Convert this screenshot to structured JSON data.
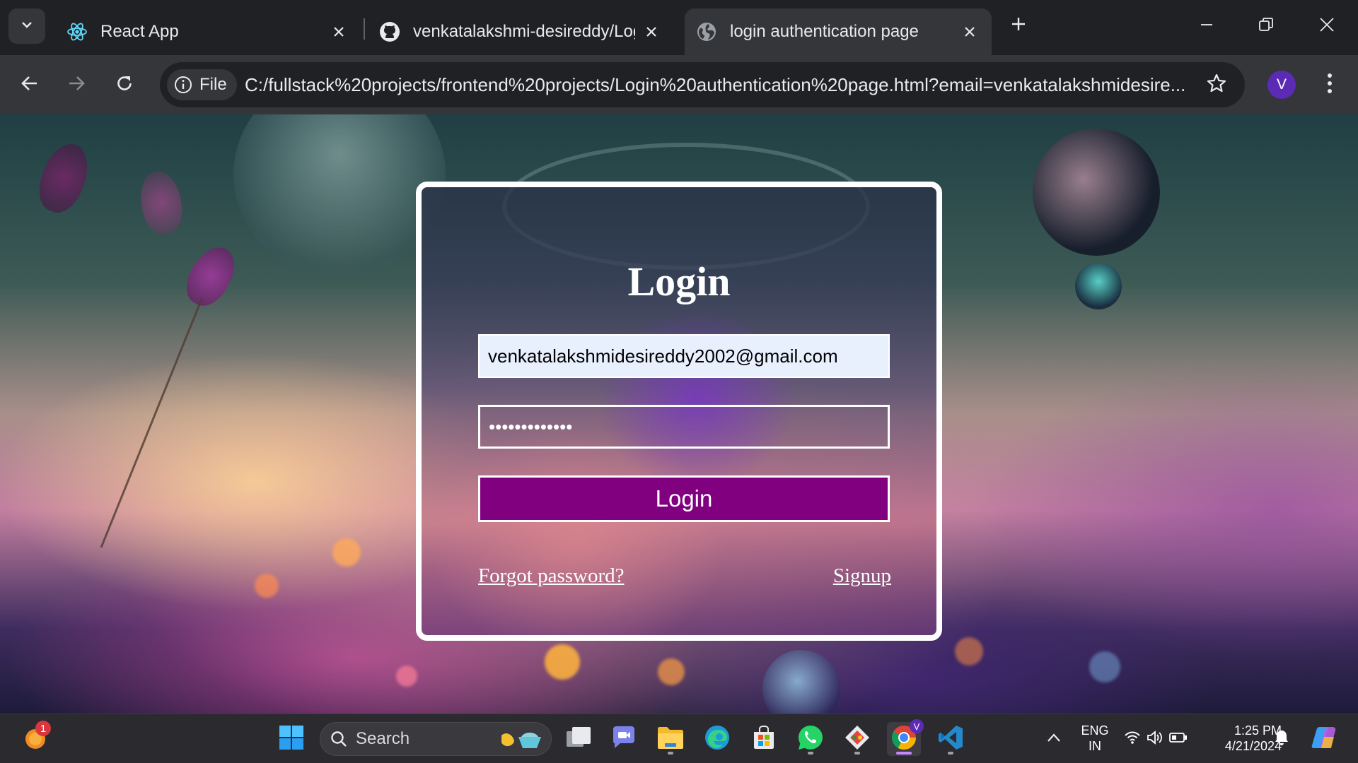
{
  "browser": {
    "tabs": [
      {
        "title": "React App",
        "favicon": "react-icon",
        "active": false
      },
      {
        "title": "venkatalakshmi-desireddy/Log",
        "favicon": "github-icon",
        "active": false
      },
      {
        "title": "login authentication page",
        "favicon": "globe-icon",
        "active": true
      }
    ],
    "site_chip": "File",
    "url": "C:/fullstack%20projects/frontend%20projects/Login%20authentication%20page.html?email=venkatalakshmidesire...",
    "profile_initial": "V"
  },
  "login": {
    "title": "Login",
    "email_value": "venkatalakshmidesireddy2002@gmail.com",
    "password_value": "•••••••••••••",
    "submit_label": "Login",
    "forgot_label": "Forgot password?",
    "signup_label": "Signup"
  },
  "taskbar": {
    "notification_count": "1",
    "search_placeholder": "Search",
    "language_line1": "ENG",
    "language_line2": "IN",
    "time": "1:25 PM",
    "date": "4/21/2024",
    "chrome_profile_badge": "V"
  },
  "colors": {
    "login_button": "#800080",
    "card_border": "#ffffff",
    "chrome_frame": "#202124",
    "chrome_toolbar": "#35363a"
  }
}
